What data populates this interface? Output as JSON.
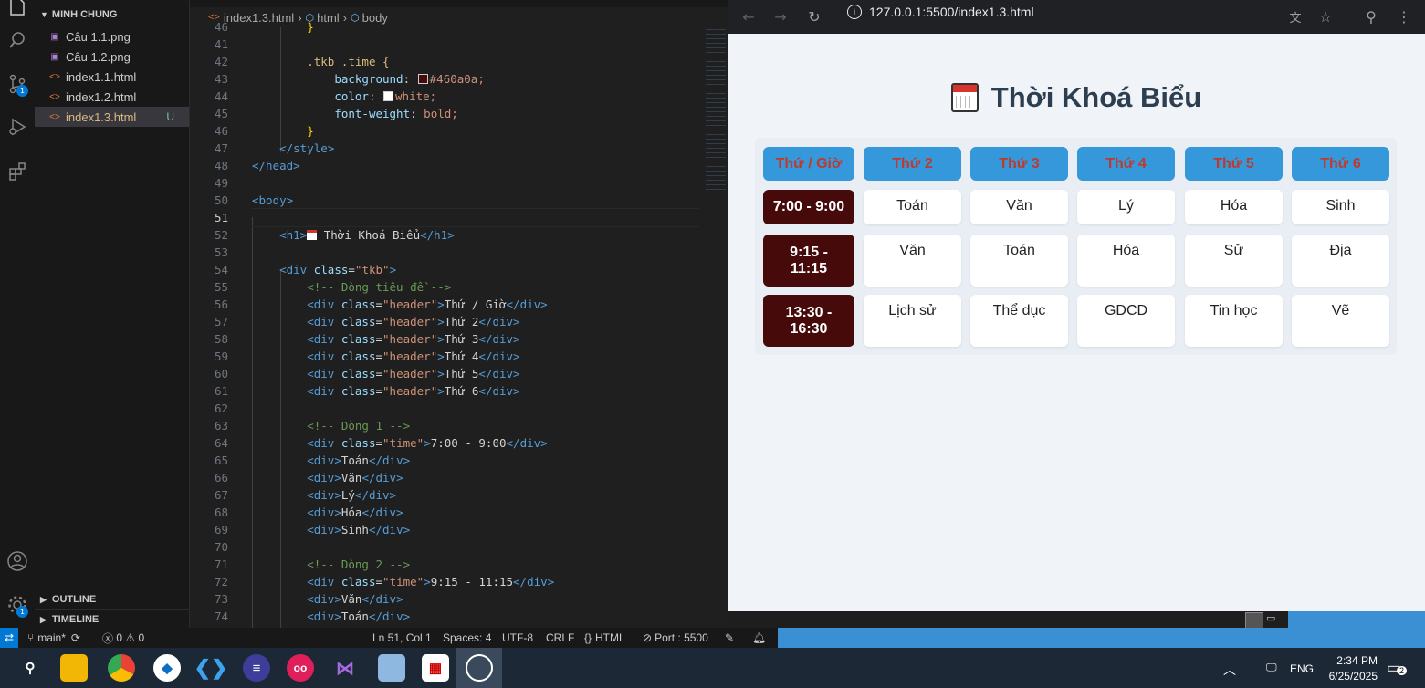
{
  "explorer": {
    "header": "MINH CHUNG",
    "files": [
      {
        "name": "Câu 1.1.png",
        "icon": "image-icon",
        "selected": false,
        "status": ""
      },
      {
        "name": "Câu 1.2.png",
        "icon": "image-icon",
        "selected": false,
        "status": ""
      },
      {
        "name": "index1.1.html",
        "icon": "html-file-icon",
        "selected": false,
        "status": ""
      },
      {
        "name": "index1.2.html",
        "icon": "html-file-icon",
        "selected": false,
        "status": ""
      },
      {
        "name": "index1.3.html",
        "icon": "html-file-icon",
        "selected": true,
        "status": "U"
      }
    ],
    "outline": "OUTLINE",
    "timeline": "TIMELINE"
  },
  "activity_badges": {
    "source_control": "1",
    "settings": "1"
  },
  "breadcrumb": {
    "file": "index1.3.html",
    "html": "html",
    "body": "body"
  },
  "editor": {
    "current_line": 51,
    "lines": [
      "46",
      "41",
      "42",
      "43",
      "44",
      "45",
      "46",
      "47",
      "48",
      "49",
      "50",
      "51",
      "52",
      "53",
      "54",
      "55",
      "56",
      "57",
      "58",
      "59",
      "60",
      "61",
      "62",
      "63",
      "64",
      "65",
      "66",
      "67",
      "68",
      "69",
      "70",
      "71",
      "72",
      "73",
      "74"
    ],
    "code": {
      "l46": "}",
      "l42_sel": ".tkb .time {",
      "l43_prop": "background",
      "l43_val": "#460a0a;",
      "l44_prop": "color",
      "l44_val": "white;",
      "l45_prop": "font-weight",
      "l45_val": "bold;",
      "l46b": "}",
      "l47": "</style>",
      "l48": "</head>",
      "l50": "<body>",
      "l52_text": " Thời Khoá Biểu",
      "l54_cls": "\"tkb\"",
      "l55": "<!-- Dòng tiêu đề -->",
      "h1": "Thứ / Giờ",
      "h2": "Thứ 2",
      "h3": "Thứ 3",
      "h4": "Thứ 4",
      "h5": "Thứ 5",
      "h6": "Thứ 6",
      "l63": "<!-- Dòng 1 -->",
      "l64_time": "7:00 - 9:00",
      "l65": "Toán",
      "l66": "Văn",
      "l67": "Lý",
      "l68": "Hóa",
      "l69": "Sinh",
      "l71": "<!-- Dòng 2 -->",
      "l72_time": "9:15 - 11:15",
      "l73": "Văn",
      "l74": "Toán",
      "cls_header": "\"header\"",
      "cls_time": "\"time\""
    }
  },
  "browser": {
    "url": "127.0.0.1:5500/index1.3.html",
    "title": "Thời Khoá Biểu",
    "headers": [
      "Thứ / Giờ",
      "Thứ 2",
      "Thứ 3",
      "Thứ 4",
      "Thứ 5",
      "Thứ 6"
    ],
    "rows": [
      {
        "time": "7:00 - 9:00",
        "subjects": [
          "Toán",
          "Văn",
          "Lý",
          "Hóa",
          "Sinh"
        ]
      },
      {
        "time": "9:15 - 11:15",
        "subjects": [
          "Văn",
          "Toán",
          "Hóa",
          "Sử",
          "Địa"
        ]
      },
      {
        "time": "13:30 - 16:30",
        "subjects": [
          "Lịch sử",
          "Thể dục",
          "GDCD",
          "Tin học",
          "Vẽ"
        ]
      }
    ],
    "colors": {
      "header_bg": "#3498db",
      "header_text": "#c0392b",
      "time_bg": "#460a0a",
      "page_bg": "#f0f4f8",
      "title": "#2c3e50"
    }
  },
  "statusbar": {
    "branch": "main*",
    "errors": "0",
    "warnings": "0",
    "position": "Ln 51, Col 1",
    "spaces": "Spaces: 4",
    "encoding": "UTF-8",
    "eol": "CRLF",
    "language": "HTML",
    "port": "Port : 5500"
  },
  "taskbar": {
    "language": "ENG",
    "time": "2:34 PM",
    "date": "6/25/2025",
    "notifications": "2"
  }
}
